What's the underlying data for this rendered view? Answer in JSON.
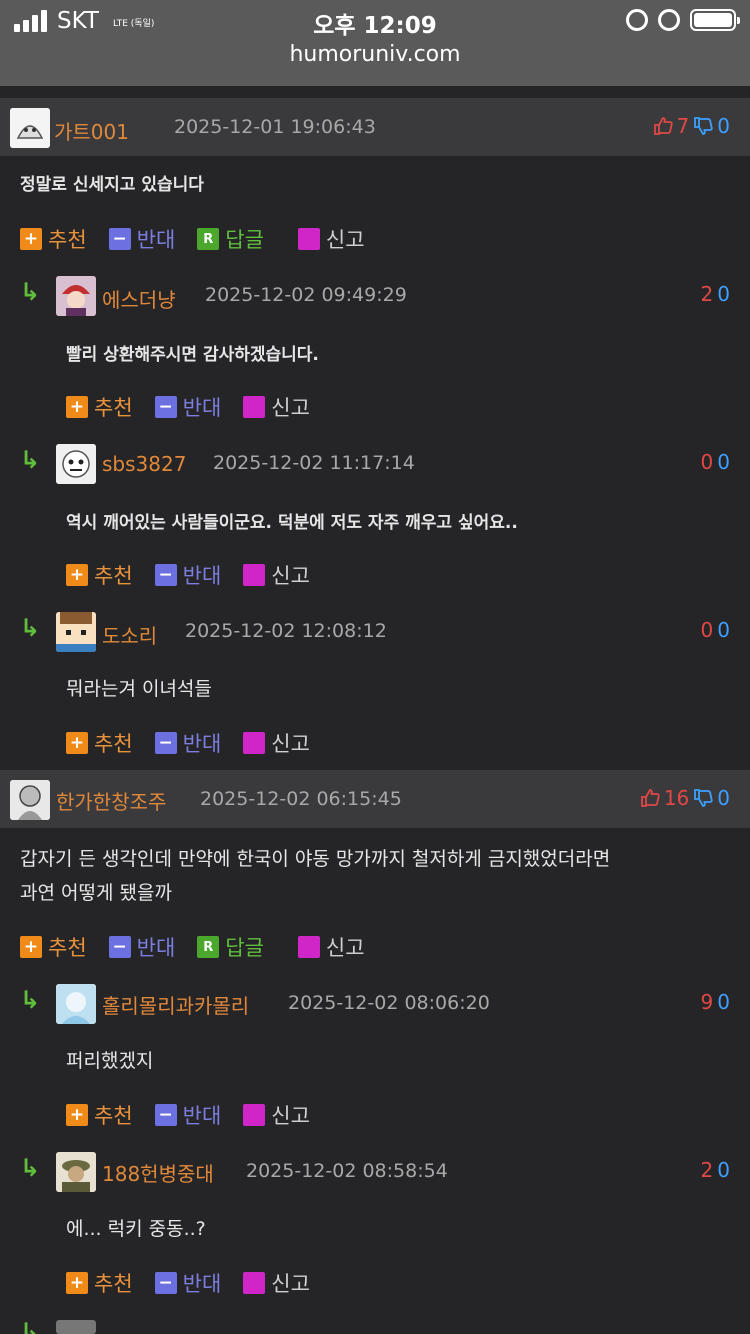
{
  "status": {
    "carrier": "SKT",
    "network": "LTE (독일)",
    "time": "오후 12:09",
    "url": "humoruniv.com"
  },
  "labels": {
    "recommend": "추천",
    "oppose": "반대",
    "reply": "답글",
    "report": "신고",
    "rec_icon": "+",
    "opp_icon": "−",
    "rep_icon": "R"
  },
  "comments": [
    {
      "nick": "가트001",
      "date": "2025-12-01 19:06:43",
      "up": "7",
      "down": "0",
      "text": "정말로 신세지고 있습니다"
    },
    {
      "nick": "에스더냥",
      "date": "2025-12-02 09:49:29",
      "up": "2",
      "down": "0",
      "text": "빨리 상환해주시면 감사하겠습니다."
    },
    {
      "nick": "sbs3827",
      "date": "2025-12-02 11:17:14",
      "up": "0",
      "down": "0",
      "text": "역시 깨어있는 사람들이군요. 덕분에 저도 자주 깨우고 싶어요.."
    },
    {
      "nick": "도소리",
      "date": "2025-12-02 12:08:12",
      "up": "0",
      "down": "0",
      "text": "뭐라는겨 이녀석들"
    },
    {
      "nick": "한가한창조주",
      "date": "2025-12-02 06:15:45",
      "up": "16",
      "down": "0",
      "text1": "갑자기 든 생각인데 만약에 한국이 야동 망가까지 철저하게 금지했었더라면",
      "text2": "과연 어떻게 됐을까"
    },
    {
      "nick": "홀리몰리과카몰리",
      "date": "2025-12-02 08:06:20",
      "up": "9",
      "down": "0",
      "text": "퍼리했겠지"
    },
    {
      "nick": "188헌병중대",
      "date": "2025-12-02 08:58:54",
      "up": "2",
      "down": "0",
      "text": "에... 럭키 중동..?"
    }
  ]
}
